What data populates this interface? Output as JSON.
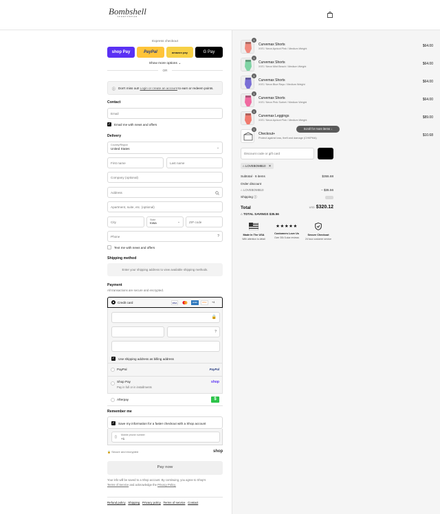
{
  "header": {
    "logo_text": "Bombshell",
    "logo_sub": "SPORTSWEAR",
    "cart_icon": "shopping-bag-icon"
  },
  "express": {
    "title": "Express checkout",
    "shoppay_label": "shop Pay",
    "paypal_label": "PayPal",
    "amazon_label": "amazon pay",
    "gpay_label": "G Pay",
    "show_more": "Show more options",
    "or_label": "OR"
  },
  "notice": {
    "prefix": "Don't miss out!",
    "link": "Login or create an account",
    "suffix": "to earn or redeem points."
  },
  "contact": {
    "title": "Contact",
    "email_placeholder": "Email",
    "news_label": "Email me with news and offers"
  },
  "delivery": {
    "title": "Delivery",
    "country_label": "Country/Region",
    "country_value": "United States",
    "first_name": "First name",
    "last_name": "Last name",
    "company": "Company (optional)",
    "address": "Address",
    "apartment": "Apartment, suite, etc. (optional)",
    "city": "City",
    "state_label": "State",
    "state_value": "Iowa",
    "zip": "ZIP code",
    "phone": "Phone",
    "text_news": "Text me with news and offers"
  },
  "shipping": {
    "title": "Shipping method",
    "message": "Enter your shipping address to view available shipping methods."
  },
  "payment": {
    "title": "Payment",
    "subtitle": "All transactions are secure and encrypted.",
    "credit_card": "Credit card",
    "card_brands": [
      "VISA",
      "MC",
      "AMEX",
      "DISC",
      "+4"
    ],
    "billing_same": "Use shipping address as billing address",
    "paypal": "PayPal",
    "paypal_logo": "PayPal",
    "shoppay": "Shop Pay",
    "shoppay_sub": "Pay in full or in installments",
    "shoppay_logo": "shop",
    "afterpay": "Afterpay"
  },
  "remember": {
    "title": "Remember me",
    "save_label": "Save my information for a faster checkout with a Shop account",
    "mobile_label": "Mobile phone number",
    "mobile_value": "+1",
    "secure": "Secure and encrypted",
    "shop_logo": "shop"
  },
  "pay_now": "Pay now",
  "terms": {
    "line1": "Your info will be saved to a Shop account. By continuing, you agree to Shop's",
    "tos": "Terms of Service",
    "and": "and acknowledge the",
    "privacy": "Privacy Policy."
  },
  "footer_links": [
    "Refund policy",
    "Shipping",
    "Privacy policy",
    "Terms of service",
    "Contact"
  ],
  "summary": {
    "items": [
      {
        "name": "Curvemax Shorts",
        "variant": "XXS / Neon Apricot Pink / Medium Weight",
        "price": "$64.00",
        "qty": "1",
        "color": "#f08a7e"
      },
      {
        "name": "Curvemax Shorts",
        "variant": "XXS / Neon Mint Beach / Medium Weight",
        "price": "$64.00",
        "qty": "1",
        "color": "#7fd4a4"
      },
      {
        "name": "Curvemax Shorts",
        "variant": "XXS / Neon Blue Rays / Medium Weight",
        "price": "$64.00",
        "qty": "1",
        "color": "#7a6fd6"
      },
      {
        "name": "Curvemax Shorts",
        "variant": "XXS / Neon Pink Sorbet / Medium Weight",
        "price": "$64.00",
        "qty": "1",
        "color": "#f06aa0"
      },
      {
        "name": "Curvemax Leggings",
        "variant": "XXS / Neon Apricot Pink / Medium Weight",
        "price": "$89.00",
        "qty": "1",
        "color": "#f07a6e"
      },
      {
        "name": "Checkout+",
        "variant": "Protect against loss, theft and damage (CHKPMA)",
        "price": "$10.68",
        "qty": "1",
        "color": "#ffffff"
      }
    ],
    "scroll_hint": "Scroll for more items",
    "discount_placeholder": "Discount code or gift card",
    "apply_label": "Apply",
    "code_tag": "LOVEBOMB10",
    "subtotal_label": "Subtotal · 6 items",
    "subtotal_value": "$355.68",
    "order_discount_label": "Order discount",
    "discount_code": "LOVEBOMB10",
    "discount_value": "− $35.56",
    "shipping_label": "Shipping",
    "total_label": "Total",
    "currency": "USD",
    "total_value": "$320.12",
    "savings_label": "TOTAL SAVINGS",
    "savings_value": "$35.56"
  },
  "badges": [
    {
      "title": "Made In The USA",
      "sub": "With attention to detail"
    },
    {
      "title": "Customers Love Us",
      "sub": "Over 30k 5-star reviews",
      "stars": "★★★★★"
    },
    {
      "title": "Secure Checkout",
      "sub": "24 hour customer service"
    }
  ],
  "colors": {
    "shoppay": "#5a31f4",
    "paypal": "#ffc439",
    "amazon": "#f7d046",
    "gpay": "#000000",
    "pay_now_bg": "#f0f0f0"
  }
}
